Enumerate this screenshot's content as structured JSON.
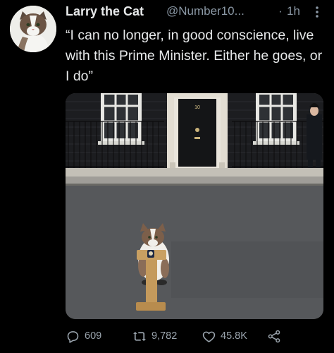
{
  "tweet": {
    "author_name": "Larry the Cat",
    "handle": "@Number10...",
    "separator": "·",
    "time": "1h",
    "text": "“I can no longer, in good conscience, live with this Prime Minister. Either he goes, or I do”"
  },
  "media": {
    "door_number": "10"
  },
  "actions": {
    "replies": "609",
    "retweets": "9,782",
    "likes": "45.8K"
  },
  "colors": {
    "background": "#000000",
    "text": "#e7e9ea",
    "secondary": "#8b98a5"
  },
  "icons": [
    "more-icon",
    "reply-icon",
    "retweet-icon",
    "like-icon",
    "share-icon"
  ]
}
